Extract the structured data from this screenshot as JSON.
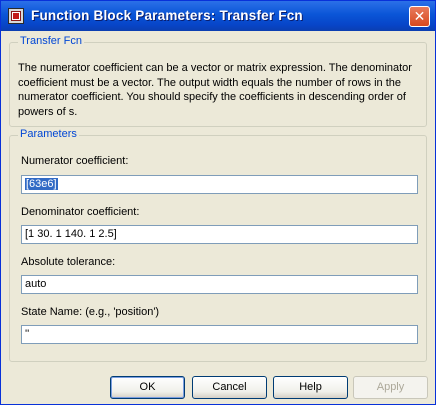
{
  "window": {
    "title": "Function Block Parameters: Transfer Fcn",
    "icon": "simulink-block-icon",
    "close_icon": "close-icon"
  },
  "block": {
    "legend": "Transfer Fcn",
    "description": "The numerator coefficient can be a vector or matrix expression. The denominator coefficient must be a vector. The output width equals the number of rows in the numerator coefficient. You should specify the coefficients in descending order of powers of s."
  },
  "parameters": {
    "legend": "Parameters",
    "numerator": {
      "label": "Numerator coefficient:",
      "value": "[63e6]"
    },
    "denominator": {
      "label": "Denominator coefficient:",
      "value": "[1 30. 1 140. 1 2.5]"
    },
    "tolerance": {
      "label": "Absolute tolerance:",
      "value": "auto"
    },
    "state_name": {
      "label": "State Name: (e.g., 'position')",
      "value": "''"
    }
  },
  "buttons": {
    "ok": "OK",
    "cancel": "Cancel",
    "help": "Help",
    "apply": "Apply"
  }
}
